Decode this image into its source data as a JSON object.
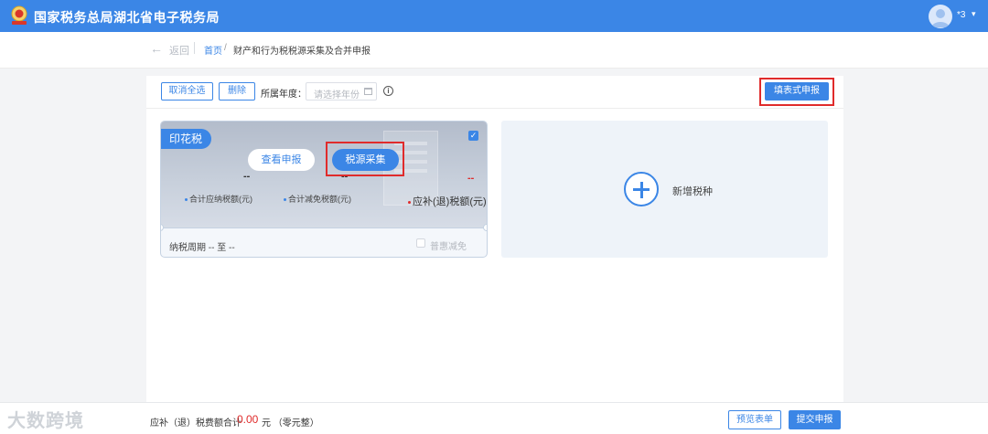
{
  "header": {
    "title": "国家税务总局湖北省电子税务局",
    "user_name": "*3",
    "logo_icon": "tax-emblem-icon",
    "caret_icon": "chevron-down-icon"
  },
  "breadcrumb": {
    "back_label": "返回",
    "home": "首页",
    "separator": "/",
    "current": "财产和行为税税源采集及合并申报"
  },
  "toolbar": {
    "cancel_all_label": "取消全选",
    "delete_label": "删除",
    "year_label": "所属年度：",
    "year_placeholder": "请选择年份",
    "fill_form_label": "填表式申报"
  },
  "tax_card": {
    "badge": "印花税",
    "checked": true,
    "view_button": "查看申报",
    "collect_button": "税源采集",
    "payable_value": "--",
    "payable_label": "合计应纳税额(元)",
    "relief_value": "--",
    "relief_label": "合计减免税额(元)",
    "refund_value": "--",
    "refund_label": "应补(退)税额(元)",
    "period_text": "纳税周期 -- 至 --",
    "relief_option": "普惠减免"
  },
  "add_card": {
    "label": "新增税种"
  },
  "footer": {
    "watermark": "大数跨境",
    "total_label": "应补（退）税费额合计",
    "total_amount": "0.00",
    "total_unit": "元 （零元整）",
    "preview_label": "预览表单",
    "submit_label": "提交申报"
  },
  "colors": {
    "primary": "#3b86e6",
    "highlight": "#e02b2b",
    "amount_red": "#e02b2b"
  }
}
